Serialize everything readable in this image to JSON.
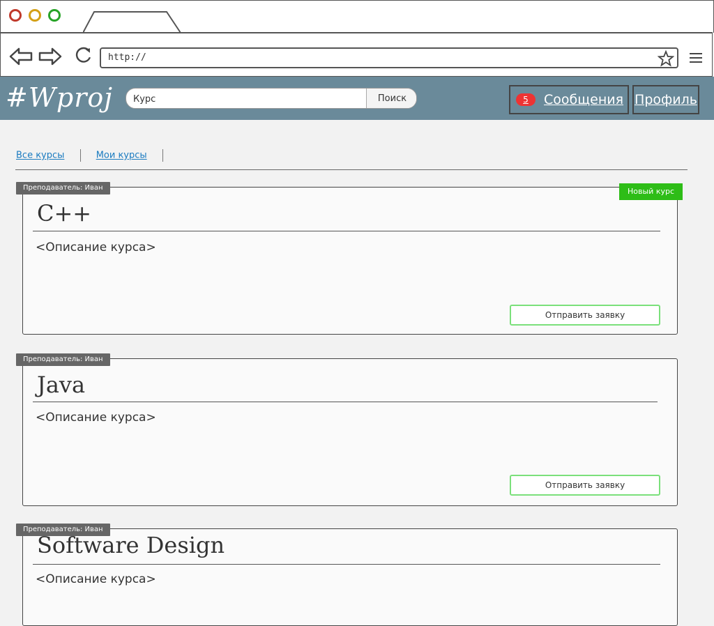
{
  "browser": {
    "url": "http://",
    "icons": [
      "back-arrow-icon",
      "forward-arrow-icon",
      "reload-icon",
      "star-icon",
      "hamburger-menu-icon"
    ]
  },
  "header": {
    "logo": "#Wproj",
    "search_value": "Курс",
    "search_button": "Поиск",
    "messages_count": "5",
    "messages_label": "Сообщения",
    "profile_label": "Профиль",
    "bg_color": "#6a8a9a"
  },
  "tabs": [
    {
      "label": "Все курсы"
    },
    {
      "label": "Мои курсы"
    }
  ],
  "courses": [
    {
      "teacher": "Преподаватель: Иван",
      "title": "C++",
      "description": "<Описание курса>",
      "badge": "Новый курс",
      "apply_label": "Отправить заявку"
    },
    {
      "teacher": "Преподаватель: Иван",
      "title": "Java",
      "description": "<Описание курса>",
      "apply_label": "Отправить заявку"
    },
    {
      "teacher": "Преподаватель: Иван",
      "title": "Software Design",
      "description": "<Описание курса>"
    }
  ],
  "colors": {
    "badge_new": "#2ebd17",
    "badge_messages": "#ee3333",
    "apply_border": "#7be07b",
    "link": "#1a7bc0"
  }
}
